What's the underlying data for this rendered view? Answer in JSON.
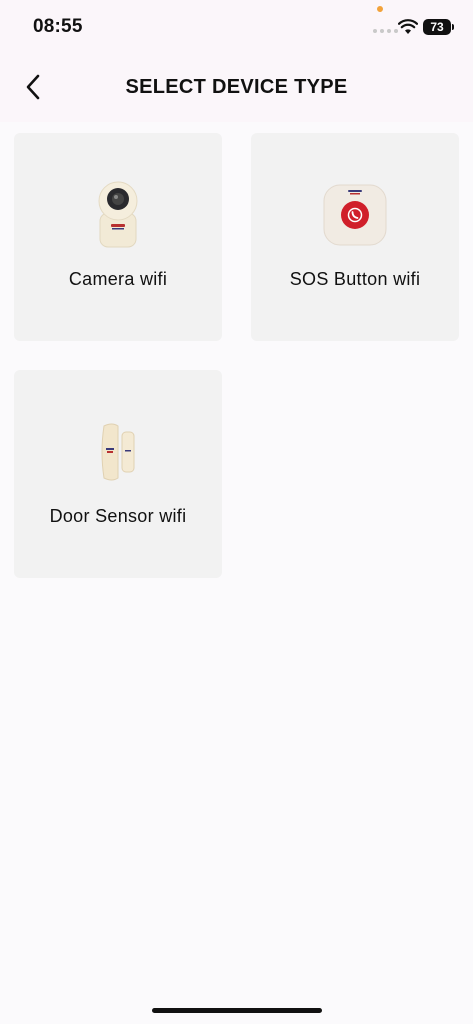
{
  "status_bar": {
    "time": "08:55",
    "battery": "73"
  },
  "header": {
    "title": "SELECT DEVICE TYPE",
    "back_icon": "chevron-left-icon"
  },
  "device_types": [
    {
      "label": "Camera wifi",
      "icon": "camera-device-icon"
    },
    {
      "label": "SOS Button wifi",
      "icon": "sos-button-device-icon"
    },
    {
      "label": "Door Sensor wifi",
      "icon": "door-sensor-device-icon"
    }
  ],
  "colors": {
    "background": "#fbfafc",
    "header_background": "#fbf6fa",
    "card_background": "#f2f2f2",
    "sos_red": "#d01f2a",
    "device_body": "#f3ead8"
  }
}
